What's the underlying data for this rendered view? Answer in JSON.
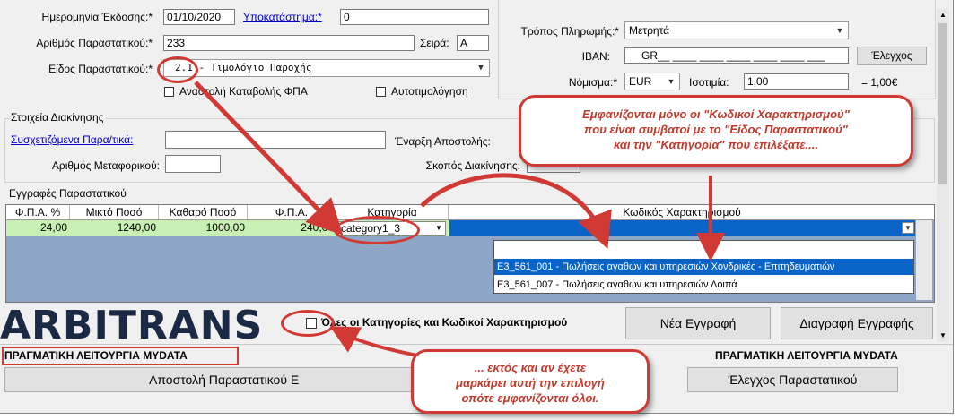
{
  "header_left": {
    "issue_date_label": "Ημερομηνία Έκδοσης:*",
    "issue_date_value": "01/10/2020",
    "branch_label": "Υποκατάστημα:*",
    "branch_value": "0",
    "doc_number_label": "Αριθμός Παραστατικού:*",
    "doc_number_value": "233",
    "series_label": "Σειρά:",
    "series_value": "A",
    "doc_type_label": "Είδος Παραστατικού:*",
    "doc_type_value": "2.1 - Τιμολόγιο Παροχής",
    "vat_suspension_label": "Αναστολή Καταβολής ΦΠΑ",
    "self_invoicing_label": "Αυτοτιμολόγηση"
  },
  "header_right": {
    "payment_method_label": "Τρόπος Πληρωμής:*",
    "payment_method_value": "Μετρητά",
    "iban_label": "IBAN:",
    "iban_value": "GR__ ____ ____ ____ ____ ____ ___",
    "check_button": "Έλεγχος",
    "currency_label": "Νόμισμα:*",
    "currency_value": "EUR",
    "parity_label": "Ισοτιμία:",
    "parity_value": "1,00",
    "parity_result": "= 1,00€"
  },
  "shipping": {
    "group_title": "Στοιχεία Διακίνησης",
    "related_docs_label": "Συσχετιζόμενα Παρα/τικά:",
    "start_label": "Έναρξη Αποστολής:",
    "carrier_label": "Αριθμός Μεταφορικού:",
    "purpose_label": "Σκοπός Διακίνησης:"
  },
  "entries": {
    "group_title": "Εγγραφές Παραστατικού",
    "columns": [
      "Φ.Π.Α. %",
      "Μικτό Ποσό",
      "Καθαρό Ποσό",
      "Φ.Π.Α.",
      "Κατηγορία",
      "Κωδικός Χαρακτηρισμού"
    ],
    "row": {
      "vat_pct": "24,00",
      "gross": "1240,00",
      "net": "1000,00",
      "vat": "240,00",
      "category": "category1_3",
      "code": ""
    },
    "dropdown_options": [
      "",
      "E3_561_001 - Πωλήσεις αγαθών και υπηρεσιών Χονδρικές - Επιτηδευματιών",
      "E3_561_007 - Πωλήσεις αγαθών και υπηρεσιών Λοιπά"
    ],
    "selected_option_index": 1
  },
  "bottom": {
    "logo_text": "ARBITRANS",
    "all_categories_label": "Όλες οι Κατηγορίες και Κωδικοί Χαρακτηρισμού",
    "new_entry_button": "Νέα Εγγραφή",
    "delete_entry_button": "Διαγραφή Εγγραφής",
    "mode_left": "ΠΡΑΓΜΑΤΙΚΗ ΛΕΙΤΟΥΡΓΙΑ MYDATA",
    "mode_right": "ΠΡΑΓΜΑΤΙΚΗ ΛΕΙΤΟΥΡΓΙΑ MYDATA",
    "send_button": "Αποστολή Παραστατικού Ε",
    "verify_button": "Έλεγχος Παραστατικού"
  },
  "annotations": {
    "top_callout_lines": [
      "Εμφανίζονται μόνο οι \"Κωδικοί Χαρακτηρισμού\"",
      "που είναι συμβατοί με το \"Είδος Παραστατικού\"",
      "και την \"Κατηγορία\" που επιλέξατε...."
    ],
    "bottom_callout_lines": [
      "... εκτός και αν έχετε",
      "μαρκάρει αυτή την επιλογή",
      "οπότε εμφανίζονται όλοι."
    ],
    "accent_color": "#d13a34",
    "selection_color": "#0a64c8",
    "row_highlight_color": "#c8f0b4",
    "grid_bg_color": "#8ea7c8"
  }
}
